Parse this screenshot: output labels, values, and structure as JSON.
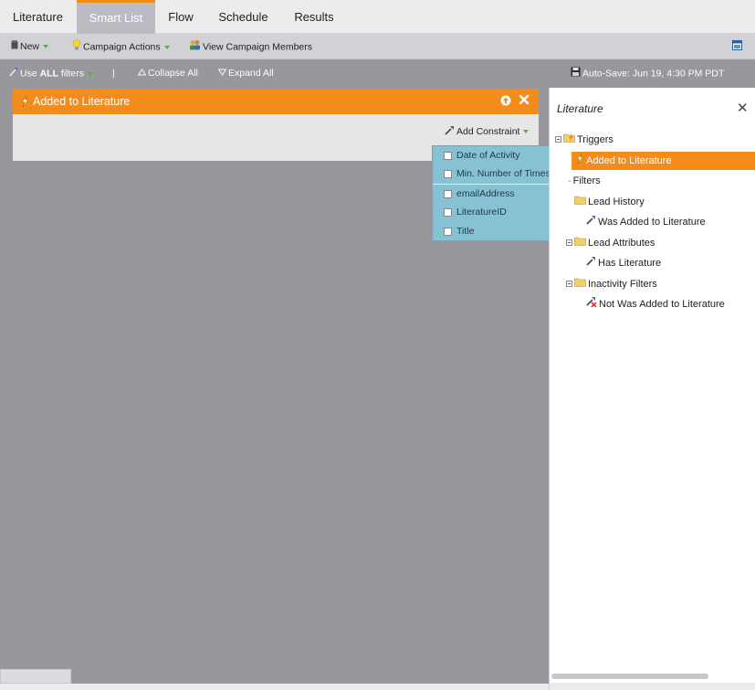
{
  "tabs": [
    {
      "label": "Literature",
      "active": false
    },
    {
      "label": "Smart List",
      "active": true
    },
    {
      "label": "Flow",
      "active": false
    },
    {
      "label": "Schedule",
      "active": false
    },
    {
      "label": "Results",
      "active": false
    }
  ],
  "toolbar": {
    "new_label": "New",
    "campaign_actions_label": "Campaign Actions",
    "view_members_label": "View Campaign Members"
  },
  "filterbar": {
    "use_prefix": "Use ",
    "use_all": "ALL",
    "use_suffix": " filters",
    "separator": "|",
    "collapse_all": "Collapse All",
    "expand_all": "Expand All",
    "autosave": "Auto-Save: Jun 19, 4:30 PM PDT"
  },
  "trigger": {
    "title": "Added to Literature",
    "add_constraint_label": "Add Constraint"
  },
  "constraint_menu": {
    "items": [
      {
        "label": "Date of Activity",
        "checked": false
      },
      {
        "label": "Min. Number of Times",
        "checked": false
      },
      {
        "label": "emailAddress",
        "checked": false
      },
      {
        "label": "LiteratureID",
        "checked": false
      },
      {
        "label": "Title",
        "checked": false
      }
    ]
  },
  "panel": {
    "title": "Literature",
    "tree": {
      "triggers": "Triggers",
      "trigger_selected": "Added to Literature",
      "filters": "Filters",
      "lead_history": "Lead History",
      "was_added": "Was Added to Literature",
      "lead_attributes": "Lead Attributes",
      "has_literature": "Has Literature",
      "inactivity_filters": "Inactivity Filters",
      "not_was_added": "Not Was Added to Literature"
    }
  },
  "colors": {
    "accent_orange": "#f48c1c",
    "menu_blue": "#86c2d4",
    "canvas_gray": "#97979c",
    "caret_green": "#5cae3a"
  }
}
